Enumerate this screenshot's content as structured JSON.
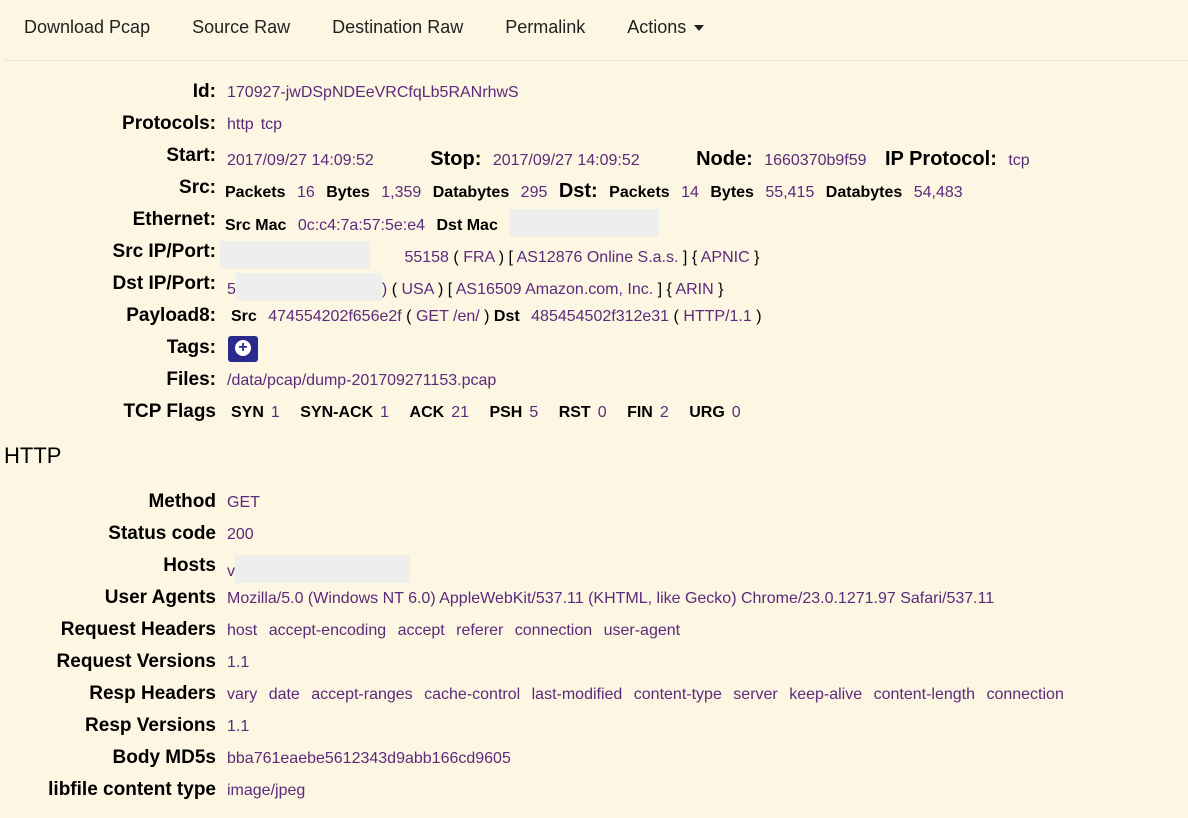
{
  "nav": {
    "download_pcap": "Download Pcap",
    "source_raw": "Source Raw",
    "destination_raw": "Destination Raw",
    "permalink": "Permalink",
    "actions": "Actions"
  },
  "session": {
    "id_label": "Id:",
    "id": "170927-jwDSpNDEeVRCfqLb5RANrhwS",
    "protocols_label": "Protocols:",
    "protocols": [
      "http",
      "tcp"
    ],
    "start_label": "Start:",
    "start": "2017/09/27 14:09:52",
    "stop_label": "Stop:",
    "stop": "2017/09/27 14:09:52",
    "node_label": "Node:",
    "node": "1660370b9f59",
    "ip_protocol_label": "IP Protocol:",
    "ip_protocol": "tcp",
    "src_label": "Src:",
    "dst_label": "Dst:",
    "packets_label": "Packets",
    "bytes_label": "Bytes",
    "databytes_label": "Databytes",
    "src_packets": "16",
    "src_bytes": "1,359",
    "src_databytes": "295",
    "dst_packets": "14",
    "dst_bytes": "55,415",
    "dst_databytes": "54,483",
    "ethernet_label": "Ethernet:",
    "src_mac_label": "Src Mac",
    "src_mac": "0c:c4:7a:57:5e:e4",
    "dst_mac_label": "Dst Mac",
    "src_ipport_label": "Src IP/Port:",
    "src_port": "55158",
    "src_country": "FRA",
    "src_as": "AS12876 Online S.a.s.",
    "src_rir": "APNIC",
    "dst_ipport_label": "Dst IP/Port:",
    "dst_ip_partial_left": "5",
    "dst_ip_partial_right": ")",
    "dst_country": "USA",
    "dst_as": "AS16509 Amazon.com, Inc.",
    "dst_rir": "ARIN",
    "payload_label": "Payload8:",
    "payload_src_label": "Src",
    "payload_src_hex": "474554202f656e2f",
    "payload_src_text": "GET /en/",
    "payload_dst_label": "Dst",
    "payload_dst_hex": "485454502f312e31",
    "payload_dst_text": "HTTP/1.1",
    "tags_label": "Tags:",
    "files_label": "Files:",
    "file": "/data/pcap/dump-201709271153.pcap",
    "tcp_flags_label": "TCP Flags",
    "flags": [
      {
        "name": "SYN",
        "count": "1"
      },
      {
        "name": "SYN-ACK",
        "count": "1"
      },
      {
        "name": "ACK",
        "count": "21"
      },
      {
        "name": "PSH",
        "count": "5"
      },
      {
        "name": "RST",
        "count": "0"
      },
      {
        "name": "FIN",
        "count": "2"
      },
      {
        "name": "URG",
        "count": "0"
      }
    ]
  },
  "http": {
    "title": "HTTP",
    "method_label": "Method",
    "method": "GET",
    "status_label": "Status code",
    "status": "200",
    "hosts_label": "Hosts",
    "hosts_partial": "v",
    "ua_label": "User Agents",
    "ua": "Mozilla/5.0 (Windows NT 6.0) AppleWebKit/537.11 (KHTML, like Gecko) Chrome/23.0.1271.97 Safari/537.11",
    "req_headers_label": "Request Headers",
    "req_headers": [
      "host",
      "accept-encoding",
      "accept",
      "referer",
      "connection",
      "user-agent"
    ],
    "req_versions_label": "Request Versions",
    "req_version": "1.1",
    "resp_headers_label": "Resp Headers",
    "resp_headers": [
      "vary",
      "date",
      "accept-ranges",
      "cache-control",
      "last-modified",
      "content-type",
      "server",
      "keep-alive",
      "content-length",
      "connection"
    ],
    "resp_versions_label": "Resp Versions",
    "resp_version": "1.1",
    "body_md5_label": "Body MD5s",
    "body_md5": "bba761eaebe5612343d9abb166cd9605",
    "libfile_label": "libfile content type",
    "libfile": "image/jpeg"
  },
  "colors": {
    "background": "#fdf6e3",
    "value": "#5b2a7a",
    "tag_button": "#2a2a8e",
    "redaction": "#eeeeee"
  }
}
